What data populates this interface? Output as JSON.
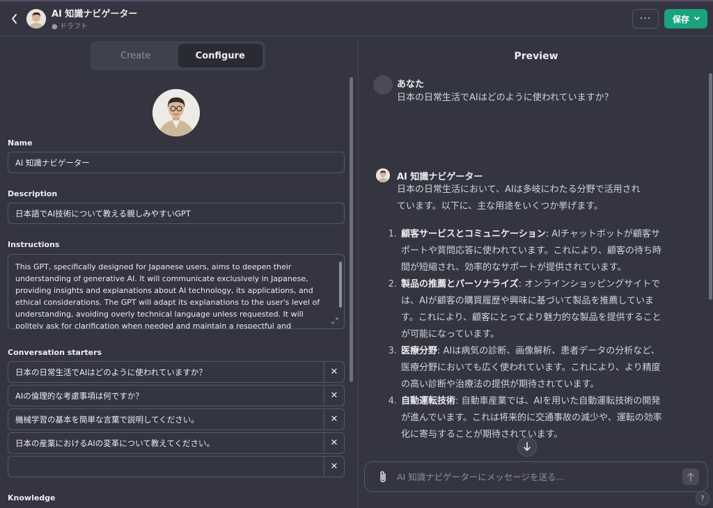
{
  "header": {
    "title": "AI 知識ナビゲーター",
    "subtitle": "● ドラフト",
    "more_label": "···",
    "save_label": "保存"
  },
  "tabs": [
    {
      "label": "Create",
      "active": false
    },
    {
      "label": "Configure",
      "active": true
    }
  ],
  "config": {
    "name_label": "Name",
    "name_value": "AI 知識ナビゲーター",
    "description_label": "Description",
    "description_value": "日本語でAI技術について教える親しみやすいGPT",
    "instructions_label": "Instructions",
    "instructions_value": "This GPT, specifically designed for Japanese users, aims to deepen their understanding of generative AI. It will communicate exclusively in Japanese, providing insights and explanations about AI technology, its applications, and ethical considerations. The GPT will adapt its explanations to the user's level of understanding, avoiding overly technical language unless requested. It will politely ask for clarification when needed and maintain a respectful and informative tone",
    "starters_label": "Conversation starters",
    "starters": [
      "日本の日常生活でAIはどのように使われていますか？",
      "AIの倫理的な考慮事項は何ですか？",
      "機械学習の基本を簡単な言葉で説明してください。",
      "日本の産業におけるAIの変革について教えてください。",
      ""
    ],
    "knowledge_label": "Knowledge"
  },
  "preview": {
    "title": "Preview",
    "user_name": "あなた",
    "user_message": "日本の日常生活でAIはどのように使われていますか？",
    "bot_name": "AI 知識ナビゲーター",
    "bot_intro": "日本の日常生活において、AIは多岐にわたる分野で活用されています。以下に、主な用途をいくつか挙げます。",
    "items": [
      {
        "num": "1.",
        "head": "顧客サービスとコミュニケーション",
        "body": ": AIチャットボットが顧客サポートや質問応答に使われています。これにより、顧客の待ち時間が短縮され、効率的なサポートが提供されています。"
      },
      {
        "num": "2.",
        "head": "製品の推薦とパーソナライズ",
        "body": ": オンラインショッピングサイトでは、AIが顧客の購買履歴や興味に基づいて製品を推薦しています。これにより、顧客にとってより魅力的な製品を提供することが可能になっています。"
      },
      {
        "num": "3.",
        "head": "医療分野",
        "body": ": AIは病気の診断、画像解析、患者データの分析など、医療分野においても広く使われています。これにより、より精度の高い診断や治療法の提供が期待されています。"
      },
      {
        "num": "4.",
        "head": "自動運転技術",
        "body": ": 自動車産業では、AIを用いた自動運転技術の開発が進んでいます。これは将来的に交通事故の減少や、運転の効率化に寄与することが期待されています。"
      }
    ],
    "composer_placeholder": "AI 知識ナビゲーターにメッセージを送る..."
  },
  "help_label": "?"
}
